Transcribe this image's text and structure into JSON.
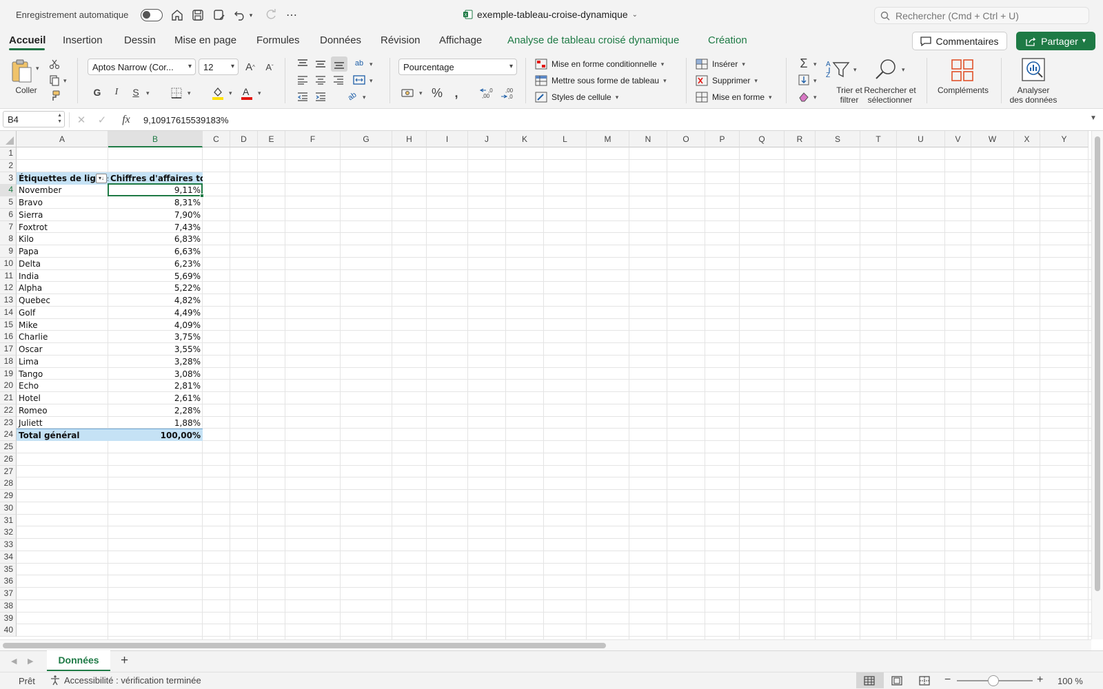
{
  "titlebar": {
    "autosave_label": "Enregistrement automatique",
    "document_title": "exemple-tableau-croise-dynamique",
    "search_placeholder": "Rechercher (Cmd + Ctrl + U)"
  },
  "tabs": [
    "Accueil",
    "Insertion",
    "Dessin",
    "Mise en page",
    "Formules",
    "Données",
    "Révision",
    "Affichage",
    "Analyse de tableau croisé dynamique",
    "Création"
  ],
  "actions": {
    "comments": "Commentaires",
    "share": "Partager"
  },
  "ribbon": {
    "paste": "Coller",
    "font_name": "Aptos Narrow (Cor...",
    "font_size": "12",
    "bold": "G",
    "italic": "I",
    "underline": "S",
    "number_format": "Pourcentage",
    "cond_format": "Mise en forme conditionnelle",
    "format_table": "Mettre sous forme de tableau",
    "cell_styles": "Styles de cellule",
    "insert": "Insérer",
    "delete": "Supprimer",
    "format": "Mise en forme",
    "sort_filter_1": "Trier et",
    "sort_filter_2": "filtrer",
    "find_select_1": "Rechercher et",
    "find_select_2": "sélectionner",
    "addins": "Compléments",
    "analyze_1": "Analyser",
    "analyze_2": "des données"
  },
  "formula_bar": {
    "name_box": "B4",
    "formula": "9,10917615539183%"
  },
  "columns": [
    "A",
    "B",
    "C",
    "D",
    "E",
    "F",
    "G",
    "H",
    "I",
    "J",
    "K",
    "L",
    "M",
    "N",
    "O",
    "P",
    "Q",
    "R",
    "S",
    "T",
    "U",
    "V",
    "W",
    "X",
    "Y"
  ],
  "pivot": {
    "header_row_label": "Étiquettes de lignes",
    "header_value_label": "Chiffres d'affaires total",
    "rows": [
      {
        "label": "November",
        "value": "9,11%"
      },
      {
        "label": "Bravo",
        "value": "8,31%"
      },
      {
        "label": "Sierra",
        "value": "7,90%"
      },
      {
        "label": "Foxtrot",
        "value": "7,43%"
      },
      {
        "label": "Kilo",
        "value": "6,83%"
      },
      {
        "label": "Papa",
        "value": "6,63%"
      },
      {
        "label": "Delta",
        "value": "6,23%"
      },
      {
        "label": "India",
        "value": "5,69%"
      },
      {
        "label": "Alpha",
        "value": "5,22%"
      },
      {
        "label": "Quebec",
        "value": "4,82%"
      },
      {
        "label": "Golf",
        "value": "4,49%"
      },
      {
        "label": "Mike",
        "value": "4,09%"
      },
      {
        "label": "Charlie",
        "value": "3,75%"
      },
      {
        "label": "Oscar",
        "value": "3,55%"
      },
      {
        "label": "Lima",
        "value": "3,28%"
      },
      {
        "label": "Tango",
        "value": "3,08%"
      },
      {
        "label": "Echo",
        "value": "2,81%"
      },
      {
        "label": "Hotel",
        "value": "2,61%"
      },
      {
        "label": "Romeo",
        "value": "2,28%"
      },
      {
        "label": "Juliett",
        "value": "1,88%"
      }
    ],
    "total_label": "Total général",
    "total_value": "100,00%"
  },
  "sheet_tab": "Données",
  "status": {
    "ready": "Prêt",
    "accessibility": "Accessibilité : vérification terminée",
    "zoom": "100 %"
  },
  "colors": {
    "accent": "#1e7a45",
    "pivot_header": "#c5e2f5"
  }
}
